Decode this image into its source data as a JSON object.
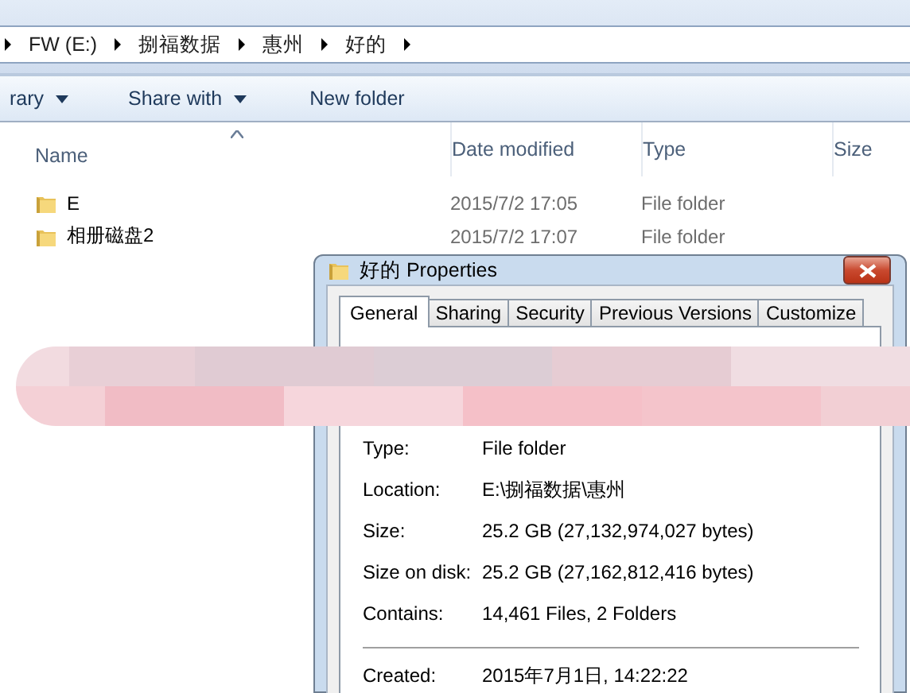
{
  "address_bar": {
    "crumbs": [
      "FW (E:)",
      "捌福数据",
      "惠州",
      "好的"
    ]
  },
  "toolbar": [
    {
      "label": "rary",
      "kind": "menu"
    },
    {
      "label": "Share with",
      "kind": "menu"
    },
    {
      "label": "New folder",
      "kind": "button"
    }
  ],
  "file_list": {
    "columns": [
      {
        "label": "Name",
        "sorted": true
      },
      {
        "label": "Date modified",
        "sorted": false
      },
      {
        "label": "Type",
        "sorted": false
      },
      {
        "label": "Size",
        "sorted": false
      }
    ],
    "rows": [
      {
        "name": "E",
        "date_modified": "2015/7/2 17:05",
        "type": "File folder"
      },
      {
        "name": "相册磁盘2",
        "date_modified": "2015/7/2 17:07",
        "type": "File folder"
      }
    ]
  },
  "dialog": {
    "title": "好的 Properties",
    "tabs": [
      {
        "label": "General",
        "selected": true
      },
      {
        "label": "Sharing",
        "selected": false
      },
      {
        "label": "Security",
        "selected": false
      },
      {
        "label": "Previous Versions",
        "selected": false
      },
      {
        "label": "Customize",
        "selected": false
      }
    ],
    "properties": [
      {
        "label": "Type:",
        "value": "File folder"
      },
      {
        "label": "Location:",
        "value": "E:\\捌福数据\\惠州"
      },
      {
        "label": "Size:",
        "value": "25.2 GB (27,132,974,027 bytes)"
      },
      {
        "label": "Size on disk:",
        "value": "25.2 GB (27,162,812,416 bytes)"
      },
      {
        "label": "Contains:",
        "value": "14,461 Files, 2 Folders"
      }
    ],
    "dates": [
      {
        "label": "Created:",
        "value": "2015年7月1日, 14:22:22"
      }
    ]
  }
}
